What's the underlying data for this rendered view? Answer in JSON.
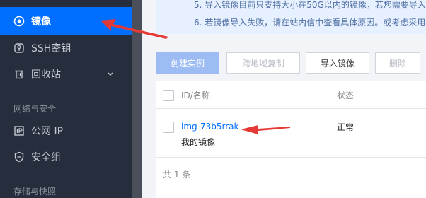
{
  "sidebar": {
    "items": [
      {
        "label": "镜像",
        "icon": "target-icon",
        "active": true
      },
      {
        "label": "SSH密钥",
        "icon": "key-icon"
      },
      {
        "label": "回收站",
        "icon": "trash-icon"
      },
      {
        "label": "公网 IP",
        "icon": "ip-icon"
      },
      {
        "label": "安全组",
        "icon": "shield-icon"
      }
    ],
    "groups": [
      "网络与安全",
      "存储与快照"
    ]
  },
  "notice": {
    "line1": "5. 导入镜像目前只支持大小在50G以内的镜像，若您需要导入更",
    "line2": "6. 若镜像导入失败，请在站内信中查看具体原因。或考虑采用"
  },
  "toolbar": {
    "create": "创建实例",
    "copy": "跨地域复制",
    "import": "导入镜像",
    "delete": "删除"
  },
  "table": {
    "headers": {
      "id": "ID/名称",
      "status": "状态"
    },
    "rows": [
      {
        "id": "img-73b5rrak",
        "name": "我的镜像",
        "status": "正常"
      }
    ],
    "footer": "共 1 条"
  },
  "colors": {
    "accent": "#006eff",
    "sidebar_bg": "#262e3d",
    "arrow": "#e53935"
  }
}
